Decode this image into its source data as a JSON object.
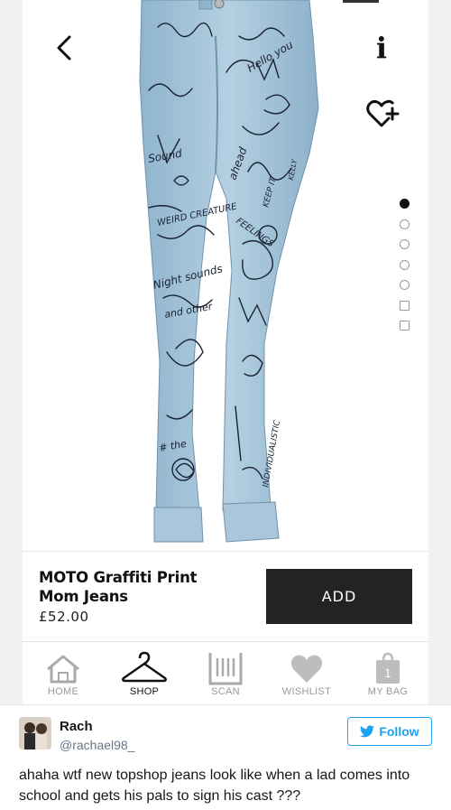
{
  "product": {
    "name": "MOTO Graffiti Print Mom Jeans",
    "price": "£52.00",
    "add_label": "ADD",
    "image_alt": "Light wash mom jeans covered in black graffiti doodles and handwritten words",
    "graffiti_words": [
      "Sound",
      "WEIRD CREATURE",
      "FEELINGS",
      "Night sounds",
      "and other",
      "KEEP IT",
      "INDIVIDUALISTIC",
      "# the",
      "Hello you",
      "ahead",
      "KELLY"
    ],
    "image_count": 7,
    "active_image": 1
  },
  "toolbar": {
    "info_label": "i"
  },
  "nav": {
    "items": [
      {
        "label": "HOME",
        "icon": "home-icon"
      },
      {
        "label": "SHOP",
        "icon": "hanger-icon"
      },
      {
        "label": "SCAN",
        "icon": "barcode-icon"
      },
      {
        "label": "WISHLIST",
        "icon": "heart-icon"
      },
      {
        "label": "MY BAG",
        "icon": "bag-icon"
      }
    ],
    "active": "SHOP",
    "bag_count": "1"
  },
  "tweet": {
    "user_name": "Rach",
    "user_handle": "@rachael98_",
    "follow_label": "Follow",
    "text": "ahaha wtf new topshop jeans look like when a lad comes into school and gets his pals to sign his cast ???"
  },
  "colors": {
    "denim": "#9ec0d6",
    "denim_dark": "#7ea6c2",
    "ink": "#1b2233",
    "add_button": "#232323",
    "twitter_blue": "#1da1f2",
    "heart_gray": "#bdbdbd"
  }
}
